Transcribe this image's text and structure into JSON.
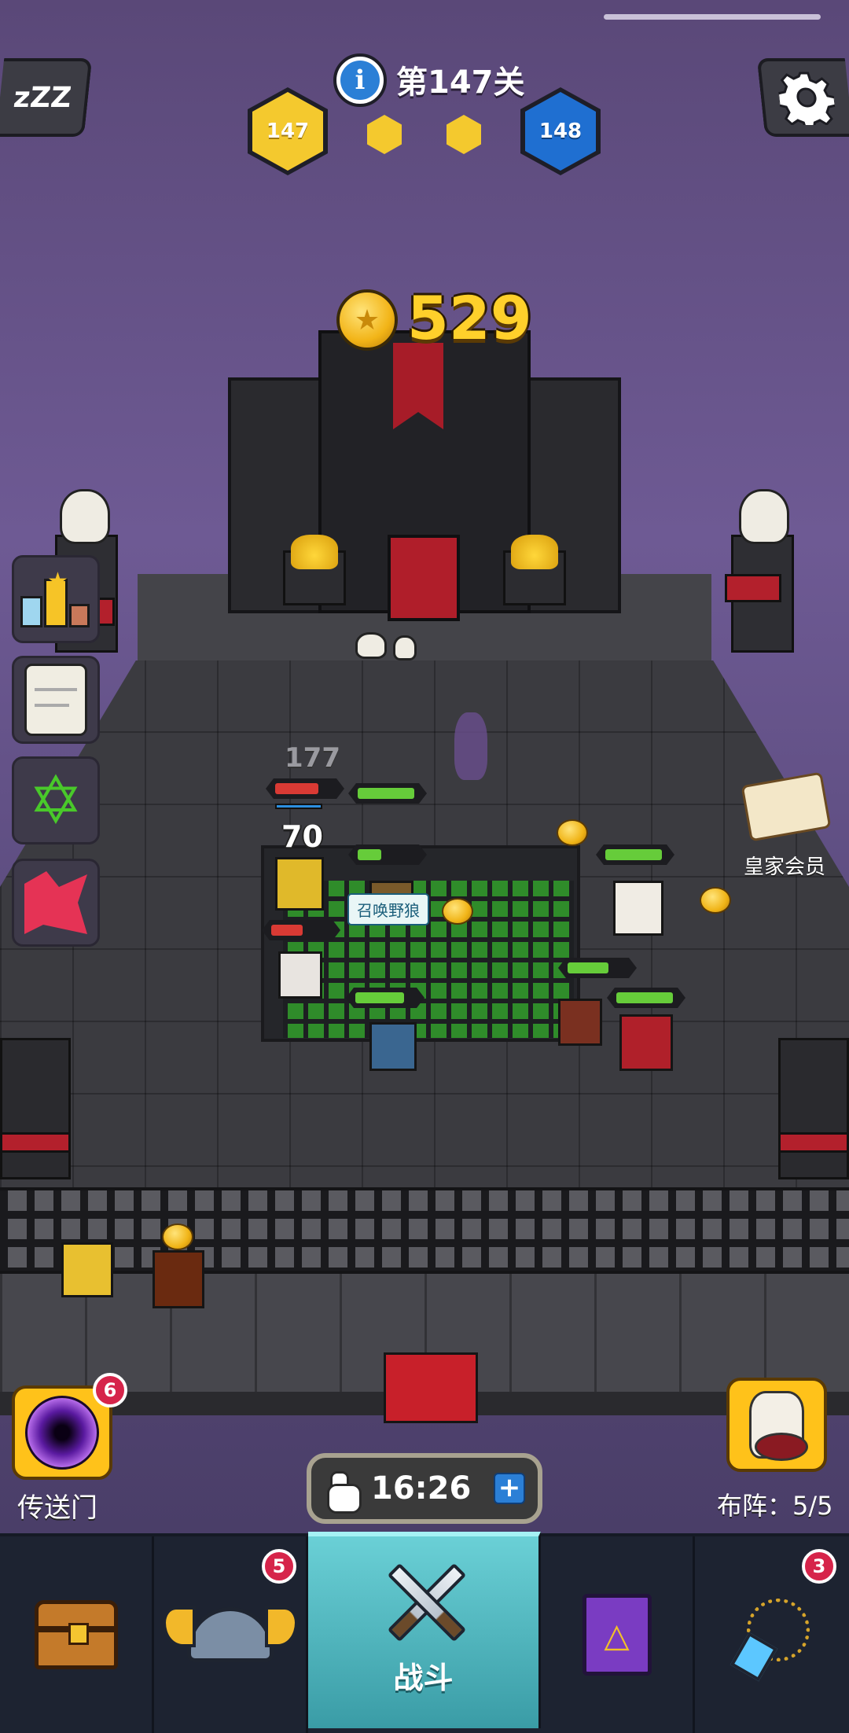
{
  "hud": {
    "level_title": "第147关",
    "current_stage": "147",
    "next_stage": "148",
    "info_glyph": "i",
    "sleep_glyph": "zZZ",
    "settings_icon": "gear-icon"
  },
  "currency": {
    "coins": "529",
    "coin_glyph": "★"
  },
  "battle": {
    "floating_numbers": [
      "177",
      "70"
    ],
    "summon_tag": "召唤野狼"
  },
  "side_menu": {
    "items": [
      {
        "name": "leaderboard",
        "icon": "trophy-podium-icon"
      },
      {
        "name": "quests",
        "icon": "scroll-icon"
      },
      {
        "name": "talents",
        "icon": "hexagram-icon",
        "glyph": "✡"
      },
      {
        "name": "events",
        "icon": "red-burst-icon"
      }
    ]
  },
  "royal": {
    "label": "皇家会员"
  },
  "portal": {
    "label": "传送门",
    "badge": "6"
  },
  "formation": {
    "label": "布阵：5/5"
  },
  "timer": {
    "value": "16:26",
    "plus": "+"
  },
  "nav": {
    "items": [
      {
        "key": "chest",
        "icon": "treasure-chest-icon"
      },
      {
        "key": "heroes",
        "icon": "winged-helmet-icon",
        "badge": "5"
      },
      {
        "key": "battle",
        "icon": "crossed-swords-icon",
        "label": "战斗",
        "active": true
      },
      {
        "key": "codex",
        "icon": "spellbook-icon",
        "glyph": "△"
      },
      {
        "key": "equipment",
        "icon": "amulet-icon",
        "badge": "3"
      }
    ]
  },
  "colors": {
    "gold": "#ffd02b",
    "nav_active": "#4fb7c0",
    "badge_red": "#d6244a",
    "hp_green": "#66cc3a",
    "hp_red": "#d93a34"
  }
}
